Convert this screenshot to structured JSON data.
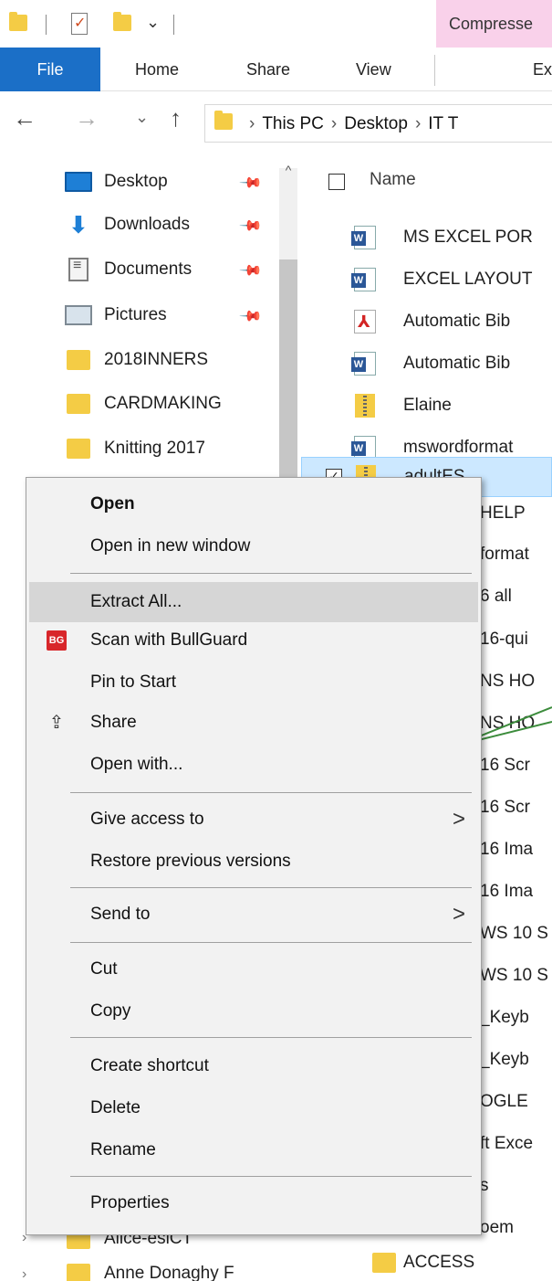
{
  "qat": {
    "icons": [
      "folder-icon",
      "properties-icon",
      "new-folder-icon",
      "customize-dropdown-icon"
    ],
    "contextual_tab_header": "Compresse"
  },
  "ribbon": {
    "tabs": [
      {
        "name": "tab-file",
        "label": "File"
      },
      {
        "name": "tab-home",
        "label": "Home"
      },
      {
        "name": "tab-share",
        "label": "Share"
      },
      {
        "name": "tab-view",
        "label": "View"
      },
      {
        "name": "tab-extract",
        "label": "Ex"
      }
    ]
  },
  "address": {
    "back": "←",
    "forward": "→",
    "recent": "⌄",
    "up": "↑",
    "breadcrumb": [
      "This PC",
      "Desktop",
      "IT T"
    ],
    "separator": "›"
  },
  "navpane": {
    "quick_access": [
      {
        "label": "Desktop",
        "icon": "desktop-icon",
        "pinned": true
      },
      {
        "label": "Downloads",
        "icon": "downloads-icon",
        "pinned": true
      },
      {
        "label": "Documents",
        "icon": "documents-icon",
        "pinned": true
      },
      {
        "label": "Pictures",
        "icon": "pictures-icon",
        "pinned": true
      },
      {
        "label": "2018INNERS",
        "icon": "folder-icon",
        "pinned": false
      },
      {
        "label": "CARDMAKING",
        "icon": "folder-icon",
        "pinned": false
      },
      {
        "label": "Knitting 2017",
        "icon": "folder-icon",
        "pinned": false
      }
    ],
    "bottom_items": [
      {
        "label": "Alice-esiCT"
      },
      {
        "label": "Anne Donaghy F"
      }
    ],
    "pin_glyph": "📌",
    "scroll_up_glyph": "^"
  },
  "filelist": {
    "column_header": "Name",
    "rows": [
      {
        "label": "MS EXCEL POR",
        "icon": "word-icon"
      },
      {
        "label": "EXCEL LAYOUT",
        "icon": "word-icon"
      },
      {
        "label": "Automatic Bib",
        "icon": "pdf-icon"
      },
      {
        "label": "Automatic Bib",
        "icon": "word-icon"
      },
      {
        "label": "Elaine",
        "icon": "zip-icon"
      },
      {
        "label": "mswordformat",
        "icon": "word-icon"
      },
      {
        "label": "adultES",
        "icon": "zip-icon",
        "selected": true
      },
      {
        "label": "HELP"
      },
      {
        "label": "format"
      },
      {
        "label": "6 all"
      },
      {
        "label": "16-qui"
      },
      {
        "label": "NS HO"
      },
      {
        "label": "NS HO"
      },
      {
        "label": "16 Scr"
      },
      {
        "label": "16 Scr"
      },
      {
        "label": "16 Ima"
      },
      {
        "label": "16 Ima"
      },
      {
        "label": "WS 10 S"
      },
      {
        "label": "WS 10 S"
      },
      {
        "label": "_Keyb"
      },
      {
        "label": "_Keyb"
      },
      {
        "label": "OGLE"
      },
      {
        "label": "ft Exce"
      },
      {
        "label": "s"
      },
      {
        "label": "oem"
      },
      {
        "label": ""
      },
      {
        "label": "ACCESS",
        "icon": "folder-icon"
      }
    ]
  },
  "context_menu": {
    "groups": [
      [
        {
          "name": "menu-open",
          "label": "Open",
          "bold": true
        },
        {
          "name": "menu-open-new-window",
          "label": "Open in new window"
        }
      ],
      [
        {
          "name": "menu-extract-all",
          "label": "Extract All...",
          "highlighted": true
        },
        {
          "name": "menu-scan-bullguard",
          "label": "Scan with BullGuard",
          "icon": "bullguard-icon"
        },
        {
          "name": "menu-pin-to-start",
          "label": "Pin to Start"
        },
        {
          "name": "menu-share",
          "label": "Share",
          "icon": "share-icon"
        },
        {
          "name": "menu-open-with",
          "label": "Open with..."
        }
      ],
      [
        {
          "name": "menu-give-access",
          "label": "Give access to",
          "submenu": true
        },
        {
          "name": "menu-restore-versions",
          "label": "Restore previous versions"
        }
      ],
      [
        {
          "name": "menu-send-to",
          "label": "Send to",
          "submenu": true
        }
      ],
      [
        {
          "name": "menu-cut",
          "label": "Cut"
        },
        {
          "name": "menu-copy",
          "label": "Copy"
        }
      ],
      [
        {
          "name": "menu-create-shortcut",
          "label": "Create shortcut"
        },
        {
          "name": "menu-delete",
          "label": "Delete"
        },
        {
          "name": "menu-rename",
          "label": "Rename"
        }
      ],
      [
        {
          "name": "menu-properties",
          "label": "Properties"
        }
      ]
    ],
    "submenu_glyph": ">",
    "bullguard_glyph": "BG",
    "share_glyph": "⇪"
  },
  "colors": {
    "file_tab": "#1b6fc7",
    "contextual_tab": "#f9d1ea",
    "selection": "#cce8ff",
    "menu_highlight": "#d6d6d6",
    "callout_line": "#3c8c3c"
  }
}
